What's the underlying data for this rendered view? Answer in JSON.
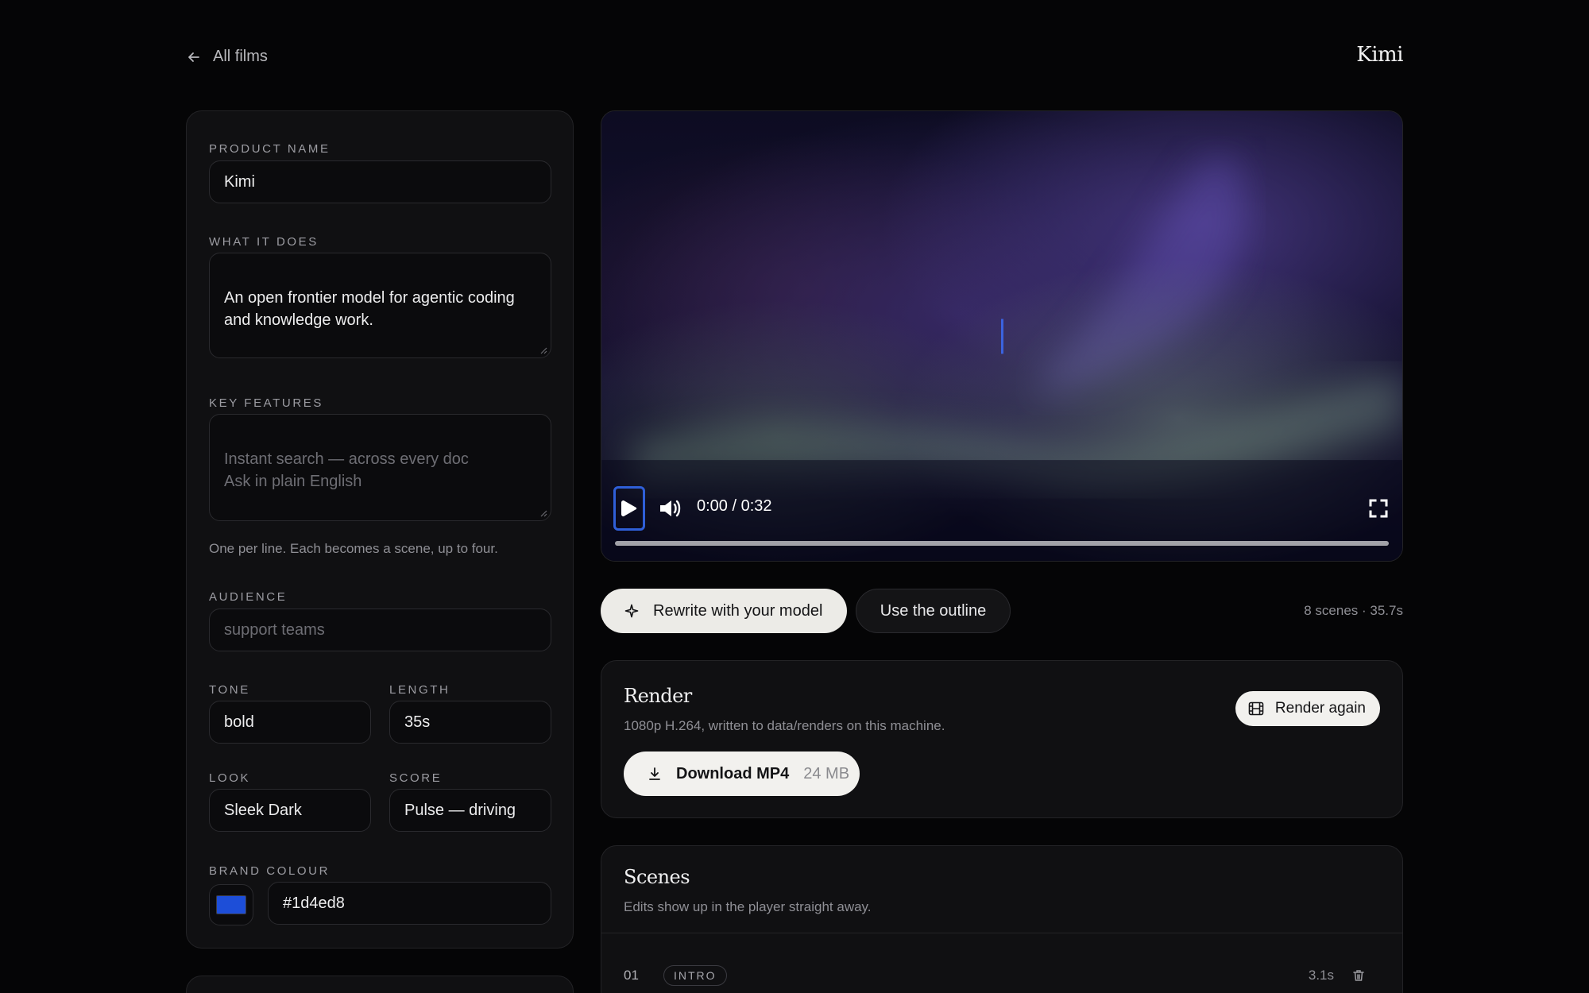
{
  "nav": {
    "back_label": "All films",
    "brand": "Kimi"
  },
  "form": {
    "product_name": {
      "label": "PRODUCT NAME",
      "value": "Kimi"
    },
    "what_it_does": {
      "label": "WHAT IT DOES",
      "value": "An open frontier model for agentic coding\nand knowledge work."
    },
    "key_features": {
      "label": "KEY FEATURES",
      "placeholder": "Instant search — across every doc\nAsk in plain English",
      "hint": "One per line. Each becomes a scene, up to four."
    },
    "audience": {
      "label": "AUDIENCE",
      "placeholder": "support teams"
    },
    "tone": {
      "label": "TONE",
      "value": "bold"
    },
    "length": {
      "label": "LENGTH",
      "value": "35s"
    },
    "look": {
      "label": "LOOK",
      "value": "Sleek Dark"
    },
    "score": {
      "label": "SCORE",
      "value": "Pulse — driving"
    },
    "brand_colour": {
      "label": "BRAND COLOUR",
      "value": "#1d4ed8"
    }
  },
  "player": {
    "timecode": "0:00 / 0:32",
    "progress": 0
  },
  "actions": {
    "rewrite_label": "Rewrite with your model",
    "outline_label": "Use the outline",
    "summary": "8 scenes · 35.7s"
  },
  "render": {
    "title": "Render",
    "subtitle": "1080p H.264, written to data/renders on this machine.",
    "render_again_label": "Render again",
    "download_label": "Download MP4",
    "download_size": "24 MB"
  },
  "scenes": {
    "title": "Scenes",
    "subtitle": "Edits show up in the player straight away.",
    "items": [
      {
        "number": "01",
        "tag": "INTRO",
        "duration": "3.1s"
      }
    ]
  },
  "colors": {
    "background": "#050506",
    "panel": "#101012",
    "accent": "#1d4ed8",
    "light_button": "#ecebe7"
  }
}
